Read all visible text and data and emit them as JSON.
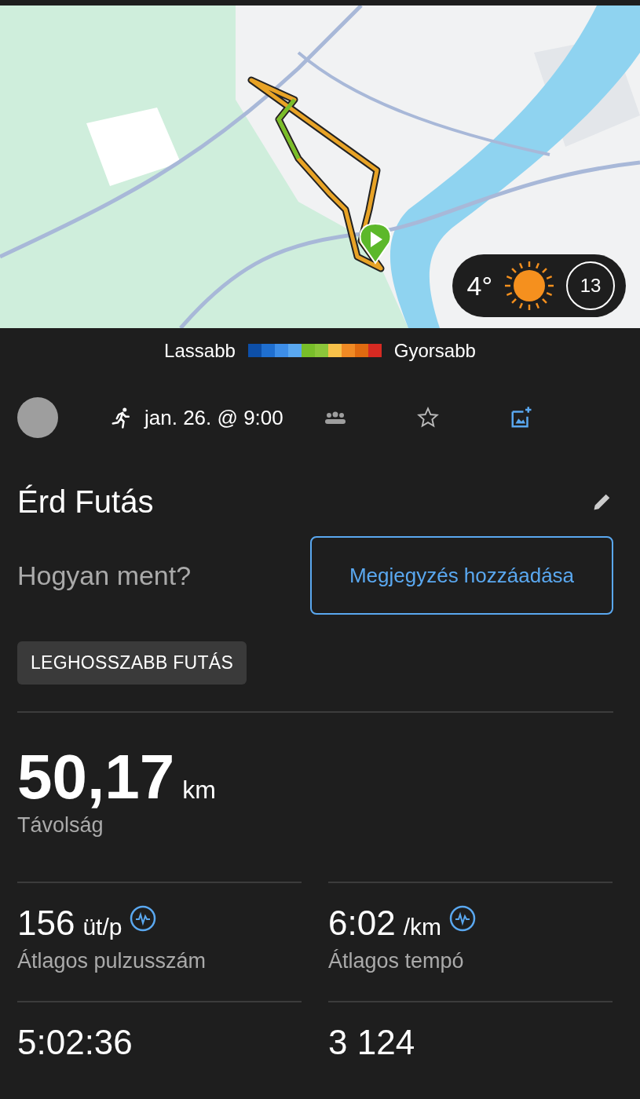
{
  "map": {
    "kind": "picture",
    "weather": {
      "temperature": "4°",
      "wind": "13"
    }
  },
  "legend": {
    "slow_label": "Lassabb",
    "fast_label": "Gyorsabb",
    "segments": [
      {
        "color": "#0d4fa8"
      },
      {
        "color": "#1f6fd0"
      },
      {
        "color": "#3d8ee8"
      },
      {
        "color": "#5aa8f0"
      },
      {
        "color": "#78be2a"
      },
      {
        "color": "#8cc63a"
      },
      {
        "color": "#f7c14a"
      },
      {
        "color": "#f08a24"
      },
      {
        "color": "#e06a10"
      },
      {
        "color": "#d62a22"
      }
    ]
  },
  "activity_bar": {
    "date": "jan. 26. @ 9:00"
  },
  "title": "Érd Futás",
  "feeling": {
    "question": "Hogyan ment?",
    "button": "Megjegyzés hozzáadása"
  },
  "badge": "LEGHOSSZABB FUTÁS",
  "distance": {
    "value": "50,17",
    "unit": "km",
    "label": "Távolság"
  },
  "stats": [
    {
      "value": "156",
      "unit": "üt/p",
      "label": "Átlagos pulzusszám",
      "chart_link": true
    },
    {
      "value": "6:02",
      "unit": "/km",
      "label": "Átlagos tempó",
      "chart_link": true
    },
    {
      "value": "5:02:36",
      "chart_link": false
    },
    {
      "value": "3 124",
      "chart_link": false
    }
  ]
}
